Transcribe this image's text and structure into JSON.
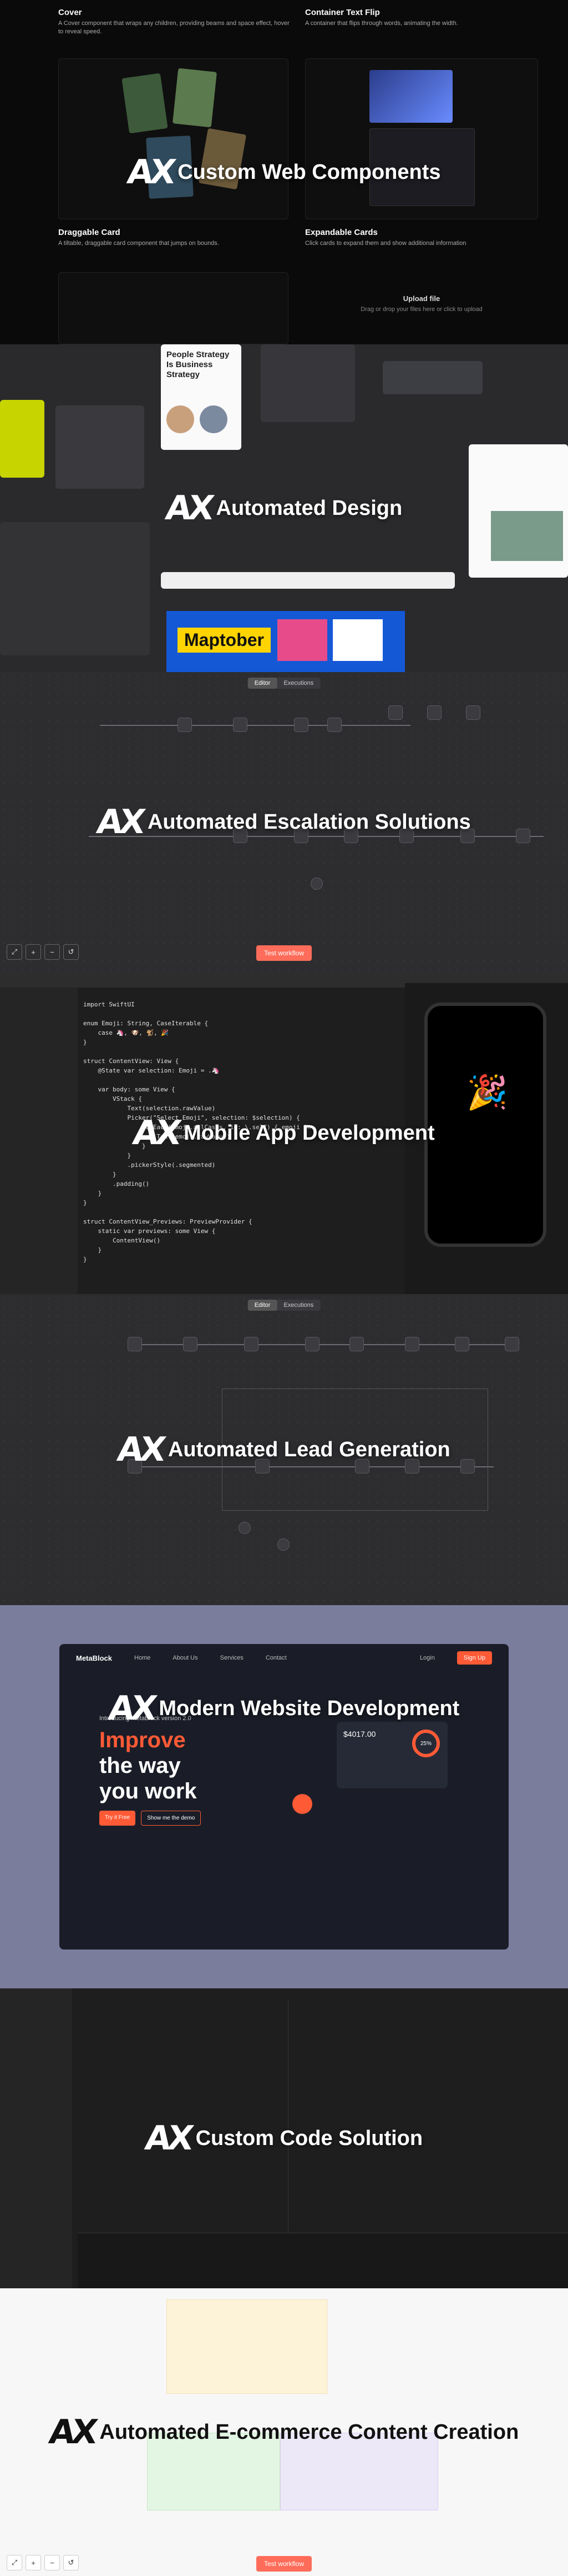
{
  "sections": [
    {
      "title": "Custom Web Components"
    },
    {
      "title": "Automated Design"
    },
    {
      "title": "Automated Escalation Solutions"
    },
    {
      "title": "Mobile App Development"
    },
    {
      "title": "Automated Lead Generation"
    },
    {
      "title": "Modern Website Development"
    },
    {
      "title": "Custom Code Solution"
    },
    {
      "title": "Automated E-commerce Content Creation"
    }
  ],
  "components": {
    "cover": {
      "title": "Cover",
      "desc": "A Cover component that wraps any children, providing beams and space effect, hover to reveal speed."
    },
    "flip": {
      "title": "Container Text Flip",
      "desc": "A container that flips through words, animating the width."
    },
    "drag": {
      "title": "Draggable Card",
      "desc": "A tiltable, draggable card component that jumps on bounds."
    },
    "expand": {
      "title": "Expandable Cards",
      "desc": "Click cards to expand them and show additional information"
    },
    "upload": {
      "title": "Upload file",
      "hint": "Drag or drop your files here or click to upload"
    }
  },
  "design": {
    "card_title": "People Strategy Is Business Strategy",
    "banner": "Maptober"
  },
  "workflow": {
    "tab_editor": "Editor",
    "tab_executions": "Executions",
    "test_button": "Test workflow"
  },
  "website": {
    "brand": "MetaBlock",
    "nav": [
      "Home",
      "About Us",
      "Services",
      "Contact"
    ],
    "login": "Login",
    "signup": "Sign Up",
    "intro": "Introducing MetaBlock version 2.0",
    "headline_1": "Improve",
    "headline_2": "the way",
    "headline_3": "you work",
    "btn_try": "Try it Free",
    "btn_demo": "Show me the demo",
    "stat": "$4017.00",
    "pct": "25%"
  },
  "swift_code": "import SwiftUI\n\nenum Emoji: String, CaseIterable {\n    case 🦄, 🐶, 🐒, 🎉\n}\n\nstruct ContentView: View {\n    @State var selection: Emoji = .🦄\n\n    var body: some View {\n        VStack {\n            Text(selection.rawValue)\n            Picker(\"Select Emoji\", selection: $selection) {\n                ForEach(Emoji.allCases, id: \\.self) { emoji in\n                    Text(emoji.rawValue)\n                }\n            }\n            .pickerStyle(.segmented)\n        }\n        .padding()\n    }\n}\n\nstruct ContentView_Previews: PreviewProvider {\n    static var previews: some View {\n        ContentView()\n    }\n}",
  "colors": {
    "accent": "#ff6d5a",
    "signup": "#ff5a36",
    "site_bg": "#1a1d27"
  }
}
